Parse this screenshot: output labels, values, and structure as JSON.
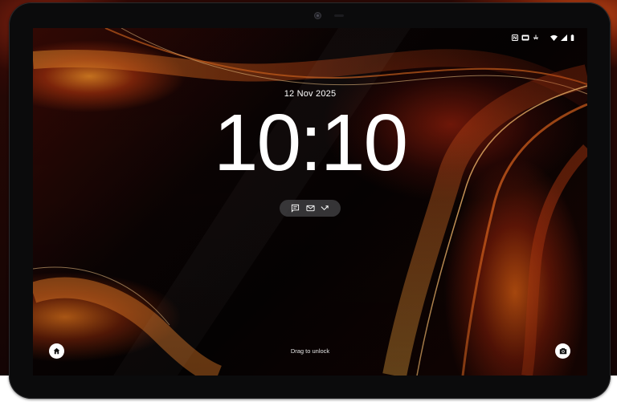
{
  "lock_screen": {
    "date": "12 Nov 2025",
    "time": "10:10",
    "unlock_hint": "Drag to unlock"
  },
  "status_bar": {
    "icons": [
      "nfc-icon",
      "data-saver-icon",
      "dnd-icon",
      "wifi-icon",
      "signal-icon",
      "battery-icon"
    ]
  },
  "notification_icons": [
    "message-icon",
    "mail-icon",
    "missed-call-icon"
  ],
  "shortcuts": {
    "left": "home-icon",
    "right": "camera-icon"
  },
  "colors": {
    "accent_orange": "#e0641a",
    "accent_red": "#b32a10",
    "text": "#ffffff"
  }
}
